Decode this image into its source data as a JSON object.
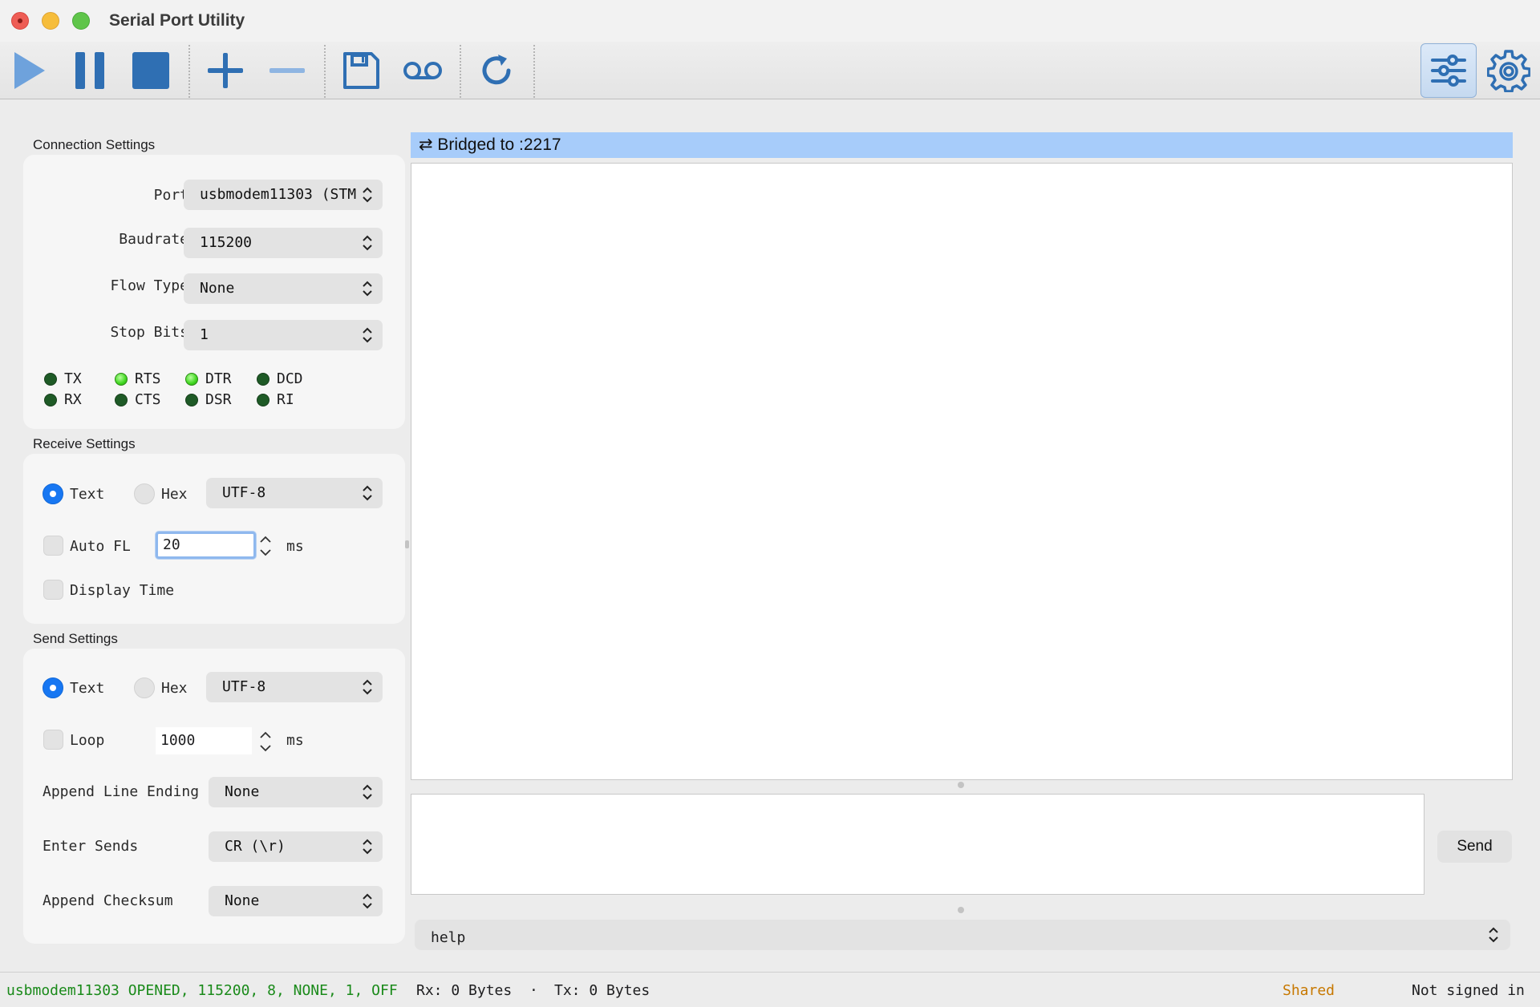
{
  "window": {
    "title": "Serial Port Utility"
  },
  "toolbar": {
    "icons": [
      "play-icon",
      "pause-icon",
      "stop-icon",
      "plus-icon",
      "minus-icon",
      "save-icon",
      "record-icon",
      "refresh-icon",
      "sliders-icon",
      "gear-icon"
    ],
    "active": "sliders-icon",
    "accent_color": "#2f6fb3"
  },
  "connection": {
    "title": "Connection Settings",
    "port_label": "Port",
    "port_value": "usbmodem11303 (STM",
    "baudrate_label": "Baudrate",
    "baudrate_value": "115200",
    "flow_label": "Flow Type",
    "flow_value": "None",
    "stop_label": "Stop Bits",
    "stop_value": "1",
    "leds": [
      {
        "label": "TX",
        "on": false
      },
      {
        "label": "RTS",
        "on": true
      },
      {
        "label": "DTR",
        "on": true
      },
      {
        "label": "DCD",
        "on": false
      },
      {
        "label": "RX",
        "on": false
      },
      {
        "label": "CTS",
        "on": false
      },
      {
        "label": "DSR",
        "on": false
      },
      {
        "label": "RI",
        "on": false
      }
    ]
  },
  "receive": {
    "title": "Receive Settings",
    "text_label": "Text",
    "hex_label": "Hex",
    "mode": "Text",
    "encoding": "UTF-8",
    "autofl_label": "Auto FL",
    "autofl_value": "20",
    "autofl_unit": "ms",
    "display_time_label": "Display Time"
  },
  "send": {
    "title": "Send Settings",
    "text_label": "Text",
    "hex_label": "Hex",
    "mode": "Text",
    "encoding": "UTF-8",
    "loop_label": "Loop",
    "loop_value": "1000",
    "loop_unit": "ms",
    "line_ending_label": "Append Line Ending",
    "line_ending_value": "None",
    "enter_sends_label": "Enter Sends",
    "enter_sends_value": "CR (\\r)",
    "checksum_label": "Append Checksum",
    "checksum_value": "None"
  },
  "main": {
    "bridge_text": "⇄ Bridged to :2217",
    "send_label": "Send",
    "command_value": "help"
  },
  "status": {
    "connection": "usbmodem11303 OPENED, 115200, 8, NONE, 1, OFF",
    "rx": "Rx: 0 Bytes",
    "separator": "·",
    "tx": "Tx: 0 Bytes",
    "shared": "Shared",
    "account": "Not signed in",
    "connection_color": "#1a8a1a",
    "shared_color": "#c77800"
  }
}
